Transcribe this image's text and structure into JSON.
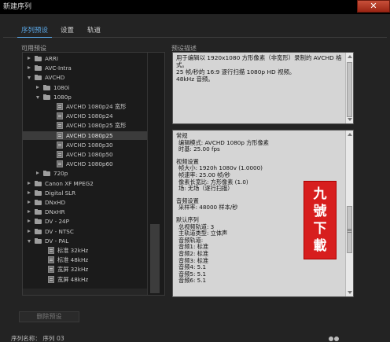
{
  "window": {
    "title": "新建序列",
    "close_glyph": "✕"
  },
  "tabs": [
    {
      "label": "序列预设",
      "active": true
    },
    {
      "label": "设置",
      "active": false
    },
    {
      "label": "轨道",
      "active": false
    }
  ],
  "left": {
    "label": "可用预设",
    "delete_button": "删除预设"
  },
  "right": {
    "label": "预设描述"
  },
  "tree": [
    {
      "label": "ARRI",
      "level": 0,
      "kind": "folder",
      "open": false
    },
    {
      "label": "AVC-Intra",
      "level": 0,
      "kind": "folder",
      "open": false
    },
    {
      "label": "AVCHD",
      "level": 0,
      "kind": "folder",
      "open": true
    },
    {
      "label": "1080i",
      "level": 1,
      "kind": "folder",
      "open": false
    },
    {
      "label": "1080p",
      "level": 1,
      "kind": "folder",
      "open": true
    },
    {
      "label": "AVCHD 1080p24 宽形",
      "level": 2,
      "kind": "file"
    },
    {
      "label": "AVCHD 1080p24",
      "level": 2,
      "kind": "file"
    },
    {
      "label": "AVCHD 1080p25 宽形",
      "level": 2,
      "kind": "file"
    },
    {
      "label": "AVCHD 1080p25",
      "level": 2,
      "kind": "file",
      "selected": true
    },
    {
      "label": "AVCHD 1080p30",
      "level": 2,
      "kind": "file"
    },
    {
      "label": "AVCHD 1080p50",
      "level": 2,
      "kind": "file"
    },
    {
      "label": "AVCHD 1080p60",
      "level": 2,
      "kind": "file"
    },
    {
      "label": "720p",
      "level": 1,
      "kind": "folder",
      "open": false
    },
    {
      "label": "Canon XF MPEG2",
      "level": 0,
      "kind": "folder",
      "open": false
    },
    {
      "label": "Digital SLR",
      "level": 0,
      "kind": "folder",
      "open": false
    },
    {
      "label": "DNxHD",
      "level": 0,
      "kind": "folder",
      "open": false
    },
    {
      "label": "DNxHR",
      "level": 0,
      "kind": "folder",
      "open": false
    },
    {
      "label": "DV - 24P",
      "level": 0,
      "kind": "folder",
      "open": false
    },
    {
      "label": "DV - NTSC",
      "level": 0,
      "kind": "folder",
      "open": false
    },
    {
      "label": "DV - PAL",
      "level": 0,
      "kind": "folder",
      "open": true
    },
    {
      "label": "标准 32kHz",
      "level": 1,
      "kind": "file"
    },
    {
      "label": "标准 48kHz",
      "level": 1,
      "kind": "file"
    },
    {
      "label": "宽屏 32kHz",
      "level": 1,
      "kind": "file"
    },
    {
      "label": "宽屏 48kHz",
      "level": 1,
      "kind": "file"
    }
  ],
  "description": {
    "top_text": "用于编辑以 1920x1080 方形像素（非宽形）录制的 AVCHD 格式。\n25 帧/秒的 16:9 逐行扫描 1080p HD 视频。\n48kHz 音频。",
    "sections": [
      {
        "lines": [
          "常规",
          "编辑模式: AVCHD 1080p 方形像素",
          "时基: 25.00 fps"
        ]
      },
      {
        "lines": [
          "视频设置",
          "帧大小: 1920h 1080v (1.0000)",
          "帧速率: 25.00  帧/秒",
          "像素长宽比: 方形像素 (1.0)",
          "场: 无场（逐行扫描）"
        ]
      },
      {
        "lines": [
          "音频设置",
          "采样率: 48000 样本/秒"
        ]
      },
      {
        "lines": [
          "默认序列",
          "总视频轨道: 3",
          "主轨道类型: 立体声",
          "音频轨道:",
          "音频1: 标准",
          "音频2: 标准",
          "音频3: 标准",
          "音频4: 5.1",
          "音频5: 5.1",
          "音频6: 5.1"
        ]
      }
    ]
  },
  "stamp": {
    "chars": [
      "九",
      "號",
      "下",
      "載"
    ]
  },
  "bottom": {
    "text": "序列名称：  序列 03"
  }
}
